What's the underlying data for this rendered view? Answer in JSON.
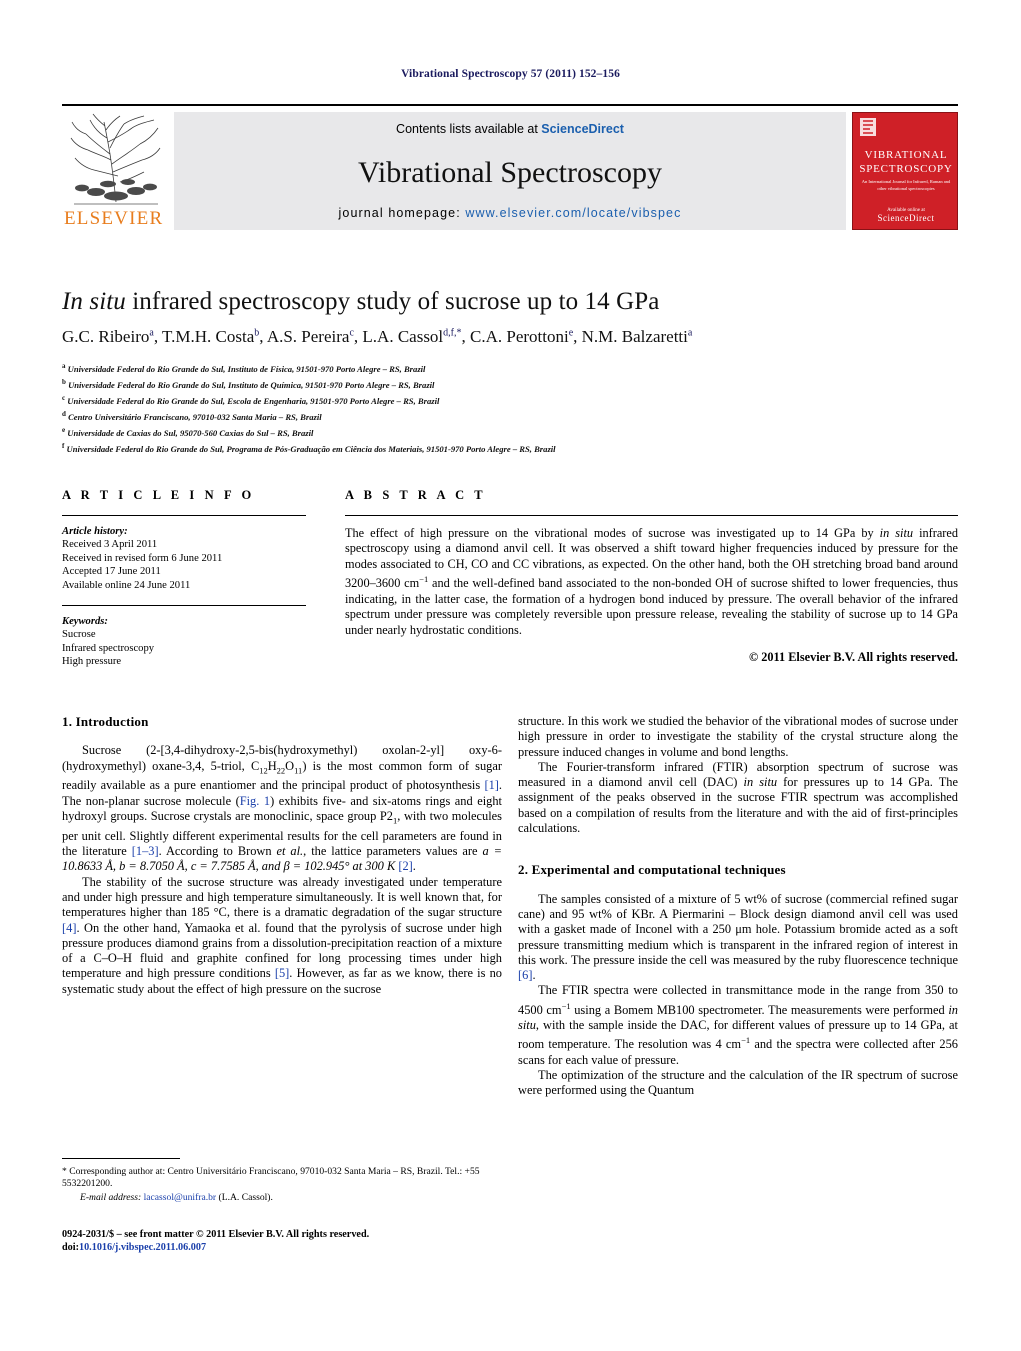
{
  "running_head": "Vibrational Spectroscopy 57 (2011) 152–156",
  "banner": {
    "contents_prefix": "Contents lists available at ",
    "contents_link": "ScienceDirect",
    "journal_name": "Vibrational Spectroscopy",
    "homepage_label": "journal homepage: ",
    "homepage_url": "www.elsevier.com/locate/vibspec",
    "publisher_wordmark": "ELSEVIER",
    "publisher_logo": "elsevier-tree-logo",
    "cover": {
      "line1": "VIBRATIONAL",
      "line2": "SPECTROSCOPY",
      "subtitle": "An International Journal for Infrared, Raman and other vibrational spectroscopies",
      "footer_brand": "ScienceDirect",
      "footer_note": "Available online at"
    }
  },
  "article": {
    "title_italic": "In situ",
    "title_rest": " infrared spectroscopy study of sucrose up to 14 GPa",
    "authors": [
      {
        "name": "G.C. Ribeiro",
        "marks": "a"
      },
      {
        "name": "T.M.H. Costa",
        "marks": "b"
      },
      {
        "name": "A.S. Pereira",
        "marks": "c"
      },
      {
        "name": "L.A. Cassol",
        "marks": "d,f,*"
      },
      {
        "name": "C.A. Perottoni",
        "marks": "e"
      },
      {
        "name": "N.M. Balzaretti",
        "marks": "a"
      }
    ],
    "affiliations": [
      {
        "mark": "a",
        "text": "Universidade Federal do Rio Grande do Sul, Instituto de Física, 91501-970 Porto Alegre – RS, Brazil"
      },
      {
        "mark": "b",
        "text": "Universidade Federal do Rio Grande do Sul, Instituto de Química, 91501-970 Porto Alegre – RS, Brazil"
      },
      {
        "mark": "c",
        "text": "Universidade Federal do Rio Grande do Sul, Escola de Engenharia, 91501-970 Porto Alegre – RS, Brazil"
      },
      {
        "mark": "d",
        "text": "Centro Universitário Franciscano, 97010-032 Santa Maria – RS, Brazil"
      },
      {
        "mark": "e",
        "text": "Universidade de Caxias do Sul, 95070-560 Caxias do Sul – RS, Brazil"
      },
      {
        "mark": "f",
        "text": "Universidade Federal do Rio Grande do Sul, Programa de Pós-Graduação em Ciência dos Materiais, 91501-970 Porto Alegre – RS, Brazil"
      }
    ]
  },
  "info": {
    "heading": "A R T I C L E   I N F O",
    "history_label": "Article history:",
    "history": [
      "Received 3 April 2011",
      "Received in revised form 6 June 2011",
      "Accepted 17 June 2011",
      "Available online 24 June 2011"
    ],
    "keywords_label": "Keywords:",
    "keywords": [
      "Sucrose",
      "Infrared spectroscopy",
      "High pressure"
    ]
  },
  "abstract": {
    "heading": "A B S T R A C T",
    "text_part1": "The effect of high pressure on the vibrational modes of sucrose was investigated up to 14 GPa by ",
    "text_italic": "in situ",
    "text_part2": " infrared spectroscopy using a diamond anvil cell. It was observed a shift toward higher frequencies induced by pressure for the modes associated to CH, CO and CC vibrations, as expected. On the other hand, both the OH stretching broad band around 3200–3600 cm",
    "text_sup": "−1",
    "text_part3": " and the well-defined band associated to the non-bonded OH of sucrose shifted to lower frequencies, thus indicating, in the latter case, the formation of a hydrogen bond induced by pressure. The overall behavior of the infrared spectrum under pressure was completely reversible upon pressure release, revealing the stability of sucrose up to 14 GPa under nearly hydrostatic conditions.",
    "copyright": "© 2011 Elsevier B.V. All rights reserved."
  },
  "sections": {
    "intro_heading": "1.  Introduction",
    "experimental_heading": "2.  Experimental and computational techniques"
  },
  "body": {
    "p1_a": "Sucrose  (2-[3,4-dihydroxy-2,5-bis(hydroxymethyl) oxolan-2-yl] oxy-6-(hydroxymethyl) oxane-3,4, 5-triol, C",
    "p1_sub1": "12",
    "p1_b": "H",
    "p1_sub2": "22",
    "p1_c": "O",
    "p1_sub3": "11",
    "p1_d": ") is the most common form of sugar readily available as a pure enantiomer and the principal product of photosynthesis ",
    "p1_cit1": "[1]",
    "p1_e": ". The non-planar sucrose molecule (",
    "p1_cit2": "Fig. 1",
    "p1_f": ") exhibits five- and six-atoms rings and eight hydroxyl groups. Sucrose crystals are monoclinic, space group P2",
    "p1_sub4": "1",
    "p1_g": ", with two molecules per unit cell. Slightly different experimental results for the cell parameters are found in the literature ",
    "p1_cit3": "[1–3]",
    "p1_h": ". According to Brown ",
    "p1_ital": "et al.",
    "p1_i": ", the lattice parameters values are ",
    "p1_params": "a = 10.8633 Å,  b = 8.7050 Å, c = 7.7585 Å, and  β = 102.945° at 300 K ",
    "p1_cit4": "[2]",
    "p1_j": ".",
    "p2_a": "The stability of the sucrose structure was already investigated under temperature and under high pressure and high temperature simultaneously. It is well known that, for temperatures higher than 185 °C, there is a dramatic degradation of the sugar structure ",
    "p2_cit1": "[4]",
    "p2_b": ". On the other hand, Yamaoka et al. found that the pyrolysis of sucrose under high pressure produces diamond grains from a dissolution-precipitation reaction of a mixture of a C–O–H fluid and graphite confined for long processing times under high temperature and high pressure conditions ",
    "p2_cit2": "[5]",
    "p2_c": ". However, as far as we know, there is no systematic study about the effect of high pressure on the sucrose",
    "p3_a": "structure. In this work we studied the behavior of the vibrational modes of sucrose under high pressure in order to investigate the stability of the crystal structure along the pressure induced changes in volume and bond lengths.",
    "p4_a": "The Fourier-transform infrared (FTIR) absorption spectrum of sucrose was measured in a diamond anvil cell (DAC) ",
    "p4_ital": "in situ",
    "p4_b": " for pressures up to 14 GPa. The assignment of the peaks observed in the sucrose FTIR spectrum was accomplished based on a compilation of results from the literature and with the aid of first-principles calculations.",
    "p5_a": "The samples consisted of a mixture of 5 wt% of sucrose (commercial refined sugar cane) and 95 wt% of KBr. A Piermarini – Block design diamond anvil cell was used with a gasket made of Inconel with a 250 μm hole. Potassium bromide acted as a soft pressure transmitting medium which is transparent in the infrared region of interest in this work. The pressure inside the cell was measured by the ruby fluorescence technique ",
    "p5_cit": "[6]",
    "p5_b": ".",
    "p6_a": "The FTIR spectra were collected in transmittance mode in the range from 350 to 4500 cm",
    "p6_sup1": "−1",
    "p6_b": " using a Bomem MB100 spectrometer. The measurements were performed ",
    "p6_ital": "in situ",
    "p6_c": ", with the sample inside the DAC, for different values of pressure up to 14 GPa, at room temperature. The resolution was 4 cm",
    "p6_sup2": "−1",
    "p6_d": " and the spectra were collected after 256 scans for each value of pressure.",
    "p7_a": "The optimization of the structure and the calculation of the IR spectrum of sucrose were performed using the Quantum"
  },
  "footnotes": {
    "corresponding": "*  Corresponding author at: Centro Universitário Franciscano, 97010-032 Santa Maria – RS, Brazil. Tel.: +55 5532201200.",
    "email_label": "E-mail address:",
    "email": "lacassol@unifra.br",
    "email_owner": "(L.A. Cassol).",
    "issn_line": "0924-2031/$ – see front matter © 2011 Elsevier B.V. All rights reserved.",
    "doi_label": "doi:",
    "doi_value": "10.1016/j.vibspec.2011.06.007"
  },
  "colors": {
    "link": "#1b5fae",
    "citation": "#1a3faa",
    "elsevier_orange": "#e87d1e",
    "cover_red": "#cf2027",
    "runhead": "#1a1a5e"
  }
}
